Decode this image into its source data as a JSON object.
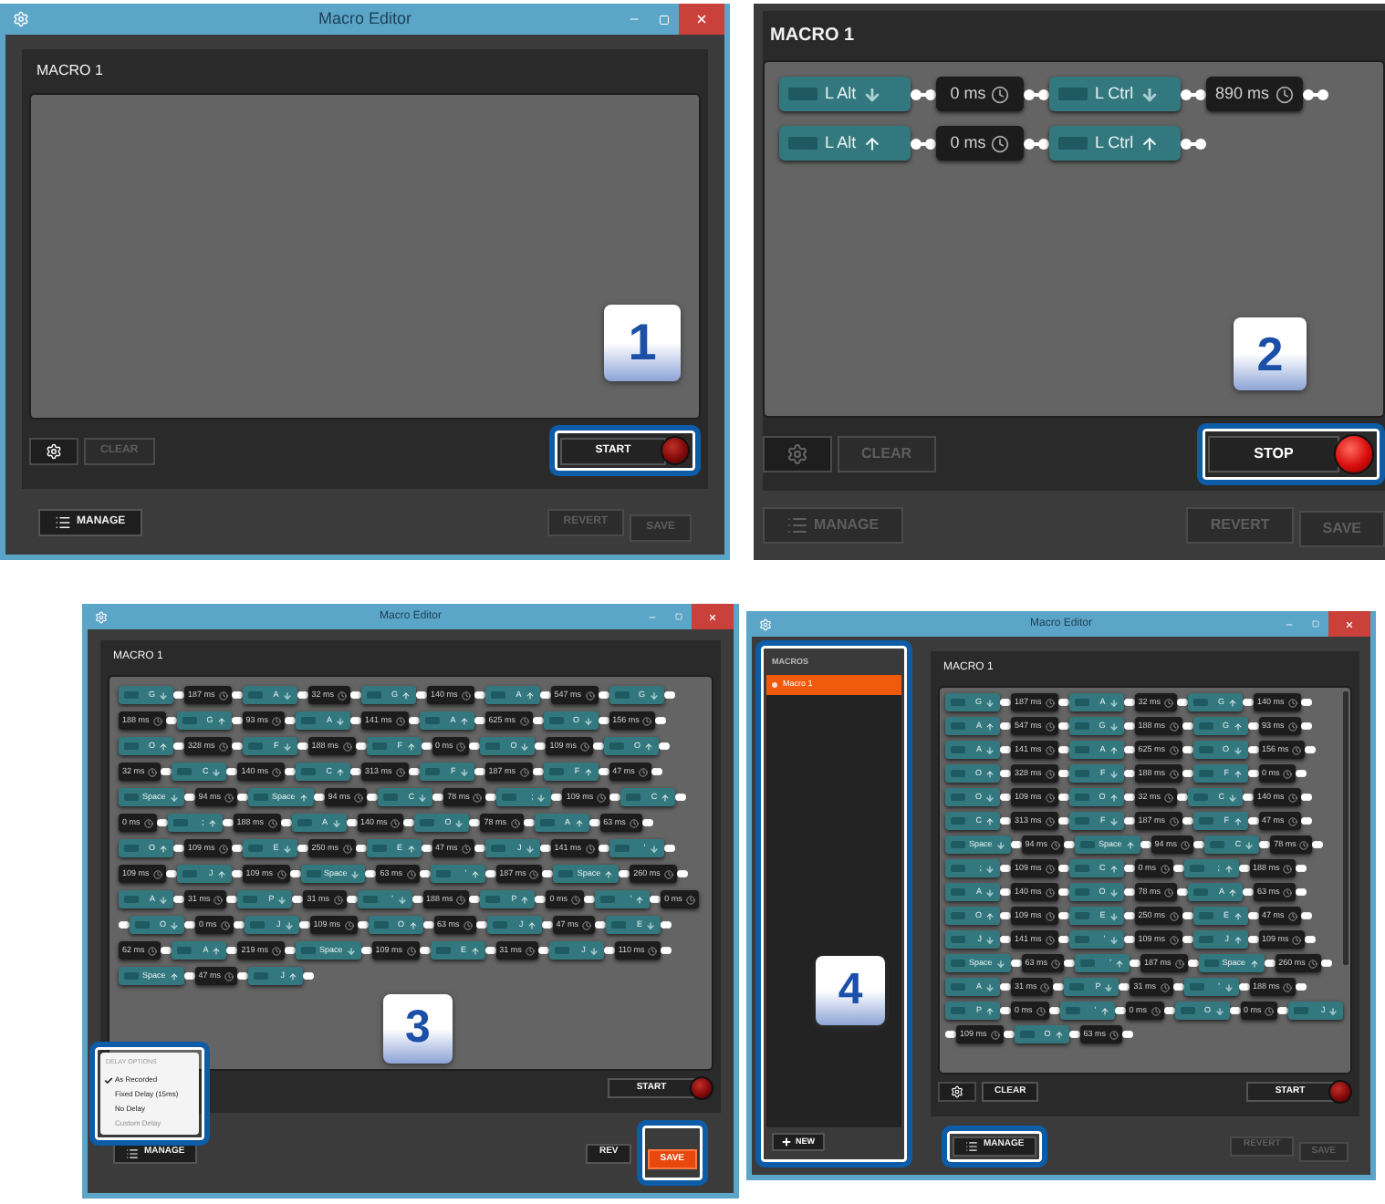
{
  "panels": [
    {
      "kind": "window",
      "title": "Macro Editor",
      "macro_name": "MACRO 1",
      "gear": {
        "disabled": false
      },
      "clear": {
        "label": "CLEAR",
        "disabled": true
      },
      "record": {
        "label": "START",
        "recording": false,
        "highlighted": true
      },
      "manage": {
        "label": "MANAGE",
        "disabled": false,
        "highlighted": false
      },
      "revert": {
        "label": "REVERT",
        "disabled": true
      },
      "save": {
        "label": "SAVE",
        "disabled": true,
        "highlighted": false
      },
      "badge": "1"
    },
    {
      "kind": "crop",
      "macro_name": "MACRO 1",
      "steps": [
        {
          "kind": "key",
          "key": "L Alt",
          "pressed": true
        },
        {
          "kind": "delay",
          "text": "0 ms"
        },
        {
          "kind": "key",
          "key": "L Ctrl",
          "pressed": true
        },
        {
          "kind": "delay",
          "text": "890 ms"
        },
        {
          "kind": "key",
          "key": "L Alt",
          "pressed": false
        },
        {
          "kind": "delay",
          "text": "0 ms"
        },
        {
          "kind": "key",
          "key": "L Ctrl",
          "pressed": false
        }
      ],
      "gear": {
        "disabled": true
      },
      "clear": {
        "label": "CLEAR",
        "disabled": true
      },
      "record": {
        "label": "STOP",
        "recording": true,
        "highlighted": true
      },
      "manage": {
        "label": "MANAGE",
        "disabled": true,
        "highlighted": false
      },
      "revert": {
        "label": "REVERT",
        "disabled": true
      },
      "save": {
        "label": "SAVE",
        "disabled": true,
        "highlighted": false
      },
      "badge": "2"
    },
    {
      "kind": "compact",
      "title": "Macro Editor",
      "macro_name": "MACRO 1",
      "steps": [
        {
          "kind": "key",
          "key": "G",
          "pressed": true
        },
        {
          "kind": "delay",
          "text": "187 ms"
        },
        {
          "kind": "key",
          "key": "A",
          "pressed": true
        },
        {
          "kind": "delay",
          "text": "32 ms"
        },
        {
          "kind": "key",
          "key": "G",
          "pressed": false
        },
        {
          "kind": "delay",
          "text": "140 ms"
        },
        {
          "kind": "key",
          "key": "A",
          "pressed": false
        },
        {
          "kind": "delay",
          "text": "547 ms"
        },
        {
          "kind": "key",
          "key": "G",
          "pressed": true
        },
        {
          "kind": "delay",
          "text": "188 ms"
        },
        {
          "kind": "key",
          "key": "G",
          "pressed": false
        },
        {
          "kind": "delay",
          "text": "93 ms"
        },
        {
          "kind": "key",
          "key": "A",
          "pressed": true
        },
        {
          "kind": "delay",
          "text": "141 ms"
        },
        {
          "kind": "key",
          "key": "A",
          "pressed": false
        },
        {
          "kind": "delay",
          "text": "625 ms"
        },
        {
          "kind": "key",
          "key": "O",
          "pressed": true
        },
        {
          "kind": "delay",
          "text": "156 ms"
        },
        {
          "kind": "key",
          "key": "O",
          "pressed": false
        },
        {
          "kind": "delay",
          "text": "328 ms"
        },
        {
          "kind": "key",
          "key": "F",
          "pressed": true
        },
        {
          "kind": "delay",
          "text": "188 ms"
        },
        {
          "kind": "key",
          "key": "F",
          "pressed": false
        },
        {
          "kind": "delay",
          "text": "0 ms"
        },
        {
          "kind": "key",
          "key": "O",
          "pressed": true
        },
        {
          "kind": "delay",
          "text": "109 ms"
        },
        {
          "kind": "key",
          "key": "O",
          "pressed": false
        },
        {
          "kind": "delay",
          "text": "32 ms"
        },
        {
          "kind": "key",
          "key": "C",
          "pressed": true
        },
        {
          "kind": "delay",
          "text": "140 ms"
        },
        {
          "kind": "key",
          "key": "C",
          "pressed": false
        },
        {
          "kind": "delay",
          "text": "313 ms"
        },
        {
          "kind": "key",
          "key": "F",
          "pressed": true
        },
        {
          "kind": "delay",
          "text": "187 ms"
        },
        {
          "kind": "key",
          "key": "F",
          "pressed": false
        },
        {
          "kind": "delay",
          "text": "47 ms"
        },
        {
          "kind": "key",
          "key": "Space",
          "pressed": true
        },
        {
          "kind": "delay",
          "text": "94 ms"
        },
        {
          "kind": "key",
          "key": "Space",
          "pressed": false
        },
        {
          "kind": "delay",
          "text": "94 ms"
        },
        {
          "kind": "key",
          "key": "C",
          "pressed": true
        },
        {
          "kind": "delay",
          "text": "78 ms"
        },
        {
          "kind": "key",
          "key": ";",
          "pressed": true
        },
        {
          "kind": "delay",
          "text": "109 ms"
        },
        {
          "kind": "key",
          "key": "C",
          "pressed": false
        },
        {
          "kind": "delay",
          "text": "0 ms"
        },
        {
          "kind": "key",
          "key": ";",
          "pressed": false
        },
        {
          "kind": "delay",
          "text": "188 ms"
        },
        {
          "kind": "key",
          "key": "A",
          "pressed": true
        },
        {
          "kind": "delay",
          "text": "140 ms"
        },
        {
          "kind": "key",
          "key": "O",
          "pressed": true
        },
        {
          "kind": "delay",
          "text": "78 ms"
        },
        {
          "kind": "key",
          "key": "A",
          "pressed": false
        },
        {
          "kind": "delay",
          "text": "63 ms"
        },
        {
          "kind": "key",
          "key": "O",
          "pressed": false
        },
        {
          "kind": "delay",
          "text": "109 ms"
        },
        {
          "kind": "key",
          "key": "E",
          "pressed": true
        },
        {
          "kind": "delay",
          "text": "250 ms"
        },
        {
          "kind": "key",
          "key": "E",
          "pressed": false
        },
        {
          "kind": "delay",
          "text": "47 ms"
        },
        {
          "kind": "key",
          "key": "J",
          "pressed": true
        },
        {
          "kind": "delay",
          "text": "141 ms"
        },
        {
          "kind": "key",
          "key": "'",
          "pressed": true
        },
        {
          "kind": "delay",
          "text": "109 ms"
        },
        {
          "kind": "key",
          "key": "J",
          "pressed": false
        },
        {
          "kind": "delay",
          "text": "109 ms"
        },
        {
          "kind": "key",
          "key": "Space",
          "pressed": true
        },
        {
          "kind": "delay",
          "text": "63 ms"
        },
        {
          "kind": "key",
          "key": "'",
          "pressed": false
        },
        {
          "kind": "delay",
          "text": "187 ms"
        },
        {
          "kind": "key",
          "key": "Space",
          "pressed": false
        },
        {
          "kind": "delay",
          "text": "260 ms"
        },
        {
          "kind": "key",
          "key": "A",
          "pressed": true
        },
        {
          "kind": "delay",
          "text": "31 ms"
        },
        {
          "kind": "key",
          "key": "P",
          "pressed": true
        },
        {
          "kind": "delay",
          "text": "31 ms"
        },
        {
          "kind": "key",
          "key": "'",
          "pressed": true
        },
        {
          "kind": "delay",
          "text": "188 ms"
        },
        {
          "kind": "key",
          "key": "P",
          "pressed": false
        },
        {
          "kind": "delay",
          "text": "0 ms"
        },
        {
          "kind": "key",
          "key": "'",
          "pressed": false
        },
        {
          "kind": "delay",
          "text": "0 ms"
        },
        {
          "kind": "key",
          "key": "O",
          "pressed": true
        },
        {
          "kind": "delay",
          "text": "0 ms"
        },
        {
          "kind": "key",
          "key": "J",
          "pressed": true
        },
        {
          "kind": "delay",
          "text": "109 ms"
        },
        {
          "kind": "key",
          "key": "O",
          "pressed": false
        },
        {
          "kind": "delay",
          "text": "63 ms"
        },
        {
          "kind": "key",
          "key": "J",
          "pressed": false
        },
        {
          "kind": "delay",
          "text": "47 ms"
        },
        {
          "kind": "key",
          "key": "E",
          "pressed": true
        },
        {
          "kind": "delay",
          "text": "62 ms"
        },
        {
          "kind": "key",
          "key": "A",
          "pressed": false
        },
        {
          "kind": "delay",
          "text": "219 ms"
        },
        {
          "kind": "key",
          "key": "Space",
          "pressed": true
        },
        {
          "kind": "delay",
          "text": "109 ms"
        },
        {
          "kind": "key",
          "key": "E",
          "pressed": false
        },
        {
          "kind": "delay",
          "text": "31 ms"
        },
        {
          "kind": "key",
          "key": "J",
          "pressed": true
        },
        {
          "kind": "delay",
          "text": "110 ms"
        },
        {
          "kind": "key",
          "key": "Space",
          "pressed": false
        },
        {
          "kind": "delay",
          "text": "47 ms"
        },
        {
          "kind": "key",
          "key": "J",
          "pressed": false
        }
      ],
      "delay_menu": {
        "title": "DELAY OPTIONS",
        "highlighted": true,
        "options": [
          {
            "label": "As Recorded",
            "checked": true,
            "disabled": false
          },
          {
            "label": "Fixed Delay (15ms)",
            "checked": false,
            "disabled": false
          },
          {
            "label": "No Delay",
            "checked": false,
            "disabled": false
          },
          {
            "label": "Custom Delay",
            "checked": false,
            "disabled": true
          }
        ]
      },
      "record": {
        "label": "START",
        "recording": false,
        "highlighted": false
      },
      "manage": {
        "label": "MANAGE",
        "disabled": false,
        "highlighted": false
      },
      "revert": {
        "label": "REV",
        "disabled": false
      },
      "save": {
        "label": "SAVE",
        "disabled": false,
        "highlighted": true
      },
      "badge": "3"
    },
    {
      "kind": "compact_manager",
      "title": "Macro Editor",
      "sidebar": {
        "title": "MACROS",
        "highlighted": true,
        "items": [
          {
            "label": "Macro 1",
            "selected": true
          }
        ],
        "new_button": {
          "label": "NEW"
        }
      },
      "macro_name": "MACRO 1",
      "steps": [
        {
          "kind": "key",
          "key": "G",
          "pressed": true
        },
        {
          "kind": "delay",
          "text": "187 ms"
        },
        {
          "kind": "key",
          "key": "A",
          "pressed": true
        },
        {
          "kind": "delay",
          "text": "32 ms"
        },
        {
          "kind": "key",
          "key": "G",
          "pressed": false
        },
        {
          "kind": "delay",
          "text": "140 ms"
        },
        {
          "kind": "key",
          "key": "A",
          "pressed": false
        },
        {
          "kind": "delay",
          "text": "547 ms"
        },
        {
          "kind": "key",
          "key": "G",
          "pressed": true
        },
        {
          "kind": "delay",
          "text": "188 ms"
        },
        {
          "kind": "key",
          "key": "G",
          "pressed": false
        },
        {
          "kind": "delay",
          "text": "93 ms"
        },
        {
          "kind": "key",
          "key": "A",
          "pressed": true
        },
        {
          "kind": "delay",
          "text": "141 ms"
        },
        {
          "kind": "key",
          "key": "A",
          "pressed": false
        },
        {
          "kind": "delay",
          "text": "625 ms"
        },
        {
          "kind": "key",
          "key": "O",
          "pressed": true
        },
        {
          "kind": "delay",
          "text": "156 ms"
        },
        {
          "kind": "key",
          "key": "O",
          "pressed": false
        },
        {
          "kind": "delay",
          "text": "328 ms"
        },
        {
          "kind": "key",
          "key": "F",
          "pressed": true
        },
        {
          "kind": "delay",
          "text": "188 ms"
        },
        {
          "kind": "key",
          "key": "F",
          "pressed": false
        },
        {
          "kind": "delay",
          "text": "0 ms"
        },
        {
          "kind": "key",
          "key": "O",
          "pressed": true
        },
        {
          "kind": "delay",
          "text": "109 ms"
        },
        {
          "kind": "key",
          "key": "O",
          "pressed": false
        },
        {
          "kind": "delay",
          "text": "32 ms"
        },
        {
          "kind": "key",
          "key": "C",
          "pressed": true
        },
        {
          "kind": "delay",
          "text": "140 ms"
        },
        {
          "kind": "key",
          "key": "C",
          "pressed": false
        },
        {
          "kind": "delay",
          "text": "313 ms"
        },
        {
          "kind": "key",
          "key": "F",
          "pressed": true
        },
        {
          "kind": "delay",
          "text": "187 ms"
        },
        {
          "kind": "key",
          "key": "F",
          "pressed": false
        },
        {
          "kind": "delay",
          "text": "47 ms"
        },
        {
          "kind": "key",
          "key": "Space",
          "pressed": true
        },
        {
          "kind": "delay",
          "text": "94 ms"
        },
        {
          "kind": "key",
          "key": "Space",
          "pressed": false
        },
        {
          "kind": "delay",
          "text": "94 ms"
        },
        {
          "kind": "key",
          "key": "C",
          "pressed": true
        },
        {
          "kind": "delay",
          "text": "78 ms"
        },
        {
          "kind": "key",
          "key": ";",
          "pressed": true
        },
        {
          "kind": "delay",
          "text": "109 ms"
        },
        {
          "kind": "key",
          "key": "C",
          "pressed": false
        },
        {
          "kind": "delay",
          "text": "0 ms"
        },
        {
          "kind": "key",
          "key": ";",
          "pressed": false
        },
        {
          "kind": "delay",
          "text": "188 ms"
        },
        {
          "kind": "key",
          "key": "A",
          "pressed": true
        },
        {
          "kind": "delay",
          "text": "140 ms"
        },
        {
          "kind": "key",
          "key": "O",
          "pressed": true
        },
        {
          "kind": "delay",
          "text": "78 ms"
        },
        {
          "kind": "key",
          "key": "A",
          "pressed": false
        },
        {
          "kind": "delay",
          "text": "63 ms"
        },
        {
          "kind": "key",
          "key": "O",
          "pressed": false
        },
        {
          "kind": "delay",
          "text": "109 ms"
        },
        {
          "kind": "key",
          "key": "E",
          "pressed": true
        },
        {
          "kind": "delay",
          "text": "250 ms"
        },
        {
          "kind": "key",
          "key": "E",
          "pressed": false
        },
        {
          "kind": "delay",
          "text": "47 ms"
        },
        {
          "kind": "key",
          "key": "J",
          "pressed": true
        },
        {
          "kind": "delay",
          "text": "141 ms"
        },
        {
          "kind": "key",
          "key": "'",
          "pressed": true
        },
        {
          "kind": "delay",
          "text": "109 ms"
        },
        {
          "kind": "key",
          "key": "J",
          "pressed": false
        },
        {
          "kind": "delay",
          "text": "109 ms"
        },
        {
          "kind": "key",
          "key": "Space",
          "pressed": true
        },
        {
          "kind": "delay",
          "text": "63 ms"
        },
        {
          "kind": "key",
          "key": "'",
          "pressed": false
        },
        {
          "kind": "delay",
          "text": "187 ms"
        },
        {
          "kind": "key",
          "key": "Space",
          "pressed": false
        },
        {
          "kind": "delay",
          "text": "260 ms"
        },
        {
          "kind": "key",
          "key": "A",
          "pressed": true
        },
        {
          "kind": "delay",
          "text": "31 ms"
        },
        {
          "kind": "key",
          "key": "P",
          "pressed": true
        },
        {
          "kind": "delay",
          "text": "31 ms"
        },
        {
          "kind": "key",
          "key": "'",
          "pressed": true
        },
        {
          "kind": "delay",
          "text": "188 ms"
        },
        {
          "kind": "key",
          "key": "P",
          "pressed": false
        },
        {
          "kind": "delay",
          "text": "0 ms"
        },
        {
          "kind": "key",
          "key": "'",
          "pressed": false
        },
        {
          "kind": "delay",
          "text": "0 ms"
        },
        {
          "kind": "key",
          "key": "O",
          "pressed": true
        },
        {
          "kind": "delay",
          "text": "0 ms"
        },
        {
          "kind": "key",
          "key": "J",
          "pressed": true
        },
        {
          "kind": "delay",
          "text": "109 ms"
        },
        {
          "kind": "key",
          "key": "O",
          "pressed": false
        },
        {
          "kind": "delay",
          "text": "63 ms"
        }
      ],
      "gear": {
        "disabled": false
      },
      "clear": {
        "label": "CLEAR",
        "disabled": false
      },
      "record": {
        "label": "START",
        "recording": false,
        "highlighted": false
      },
      "manage": {
        "label": "MANAGE",
        "disabled": false,
        "highlighted": true
      },
      "revert": {
        "label": "REVERT",
        "disabled": true
      },
      "save": {
        "label": "SAVE",
        "disabled": true,
        "highlighted": false
      },
      "badge": "4"
    }
  ]
}
